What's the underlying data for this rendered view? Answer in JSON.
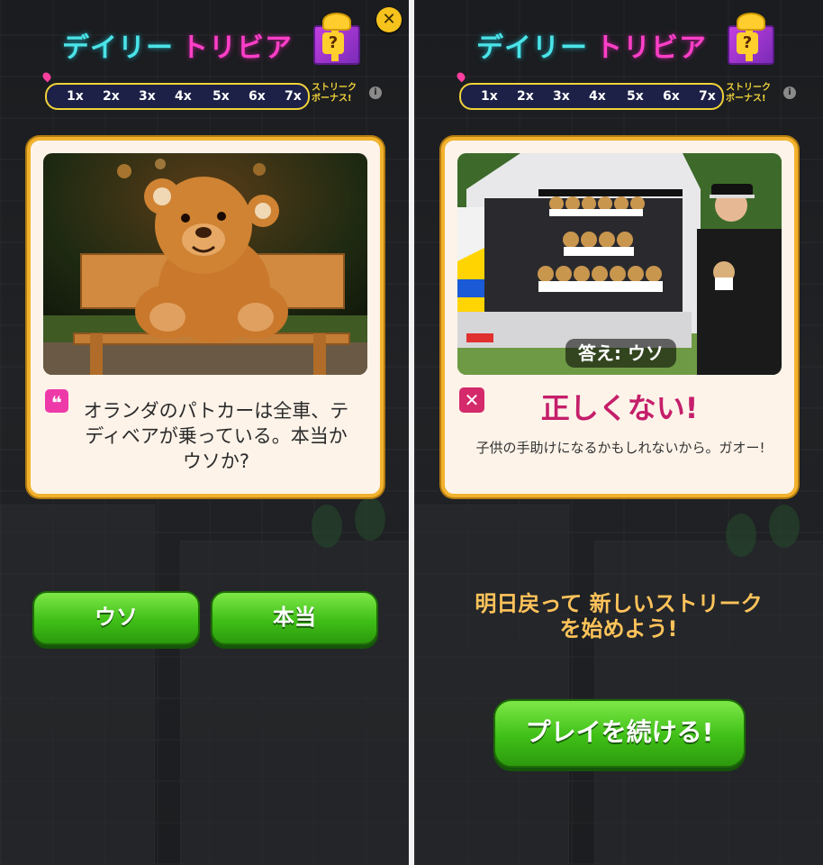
{
  "left": {
    "title_part1": "デイリー",
    "title_part2": "トリビア",
    "gift_symbol": "?",
    "close_symbol": "✕",
    "streak": [
      "1x",
      "2x",
      "3x",
      "4x",
      "5x",
      "6x",
      "7x"
    ],
    "bonus_line1": "ストリーク",
    "bonus_line2": "ボーナス!",
    "info_symbol": "i",
    "quote_symbol": "❝",
    "question": "オランダのパトカーは全車、テディベアが乗っている。本当かウソか?",
    "button_false": "ウソ",
    "button_true": "本当"
  },
  "right": {
    "title_part1": "デイリー",
    "title_part2": "トリビア",
    "gift_symbol": "?",
    "streak": [
      "1x",
      "2x",
      "3x",
      "4x",
      "5x",
      "6x",
      "7x"
    ],
    "bonus_line1": "ストリーク",
    "bonus_line2": "ボーナス!",
    "info_symbol": "i",
    "answer_label": "答え: ウソ",
    "x_symbol": "✕",
    "verdict": "正しくない!",
    "explanation": "子供の手助けになるかもしれないから。ガオー!",
    "message": "明日戻って 新しいストリークを始めよう!",
    "continue_button": "プレイを続ける!"
  },
  "colors": {
    "title_cyan": "#4be4e8",
    "title_pink": "#ff3fc8",
    "card_border": "#f2b22d",
    "button_green": "#3fbf17",
    "verdict_pink": "#c51e6a",
    "message_orange": "#ffc35a"
  }
}
